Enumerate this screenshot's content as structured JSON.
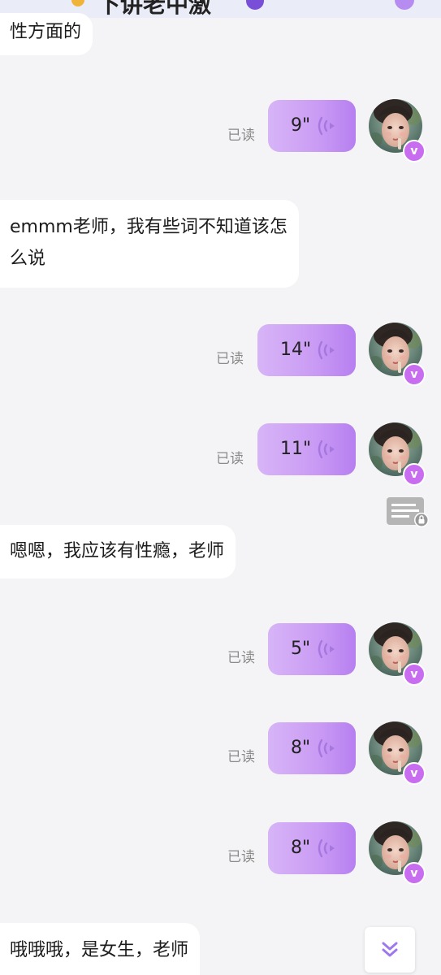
{
  "header": {
    "title_partial": "下讲老中激"
  },
  "colors": {
    "accent": "#b67ff0",
    "voice_bubble_start": "#d7b4f6",
    "voice_bubble_end": "#b67ff0",
    "badge": "#c86df0",
    "background": "#f4f4f6"
  },
  "messages": [
    {
      "type": "text",
      "side": "left",
      "text": "性方面的"
    },
    {
      "type": "voice",
      "side": "right",
      "duration": "9\"",
      "status": "已读",
      "avatar_icon": "user-avatar",
      "badge_icon": "vip-badge-icon",
      "badge_text": "v"
    },
    {
      "type": "text",
      "side": "left",
      "lines": [
        "emmm老师，我有些词不知道该怎",
        "么说"
      ]
    },
    {
      "type": "voice",
      "side": "right",
      "duration": "14\"",
      "status": "已读",
      "badge_text": "v"
    },
    {
      "type": "voice",
      "side": "right",
      "duration": "11\"",
      "status": "已读",
      "badge_text": "v"
    },
    {
      "type": "text",
      "side": "left",
      "text": "嗯嗯，我应该有性瘾，老师"
    },
    {
      "type": "voice",
      "side": "right",
      "duration": "5\"",
      "status": "已读",
      "badge_text": "v"
    },
    {
      "type": "voice",
      "side": "right",
      "duration": "8\"",
      "status": "已读",
      "badge_text": "v"
    },
    {
      "type": "voice",
      "side": "right",
      "duration": "8\"",
      "status": "已读",
      "badge_text": "v"
    },
    {
      "type": "text",
      "side": "left",
      "text": "哦哦哦，是女生，老师"
    }
  ],
  "icons": {
    "private_note": "locked-note-icon",
    "scroll_down": "double-chevron-down-icon",
    "voice_wave": "sound-wave-icon"
  }
}
